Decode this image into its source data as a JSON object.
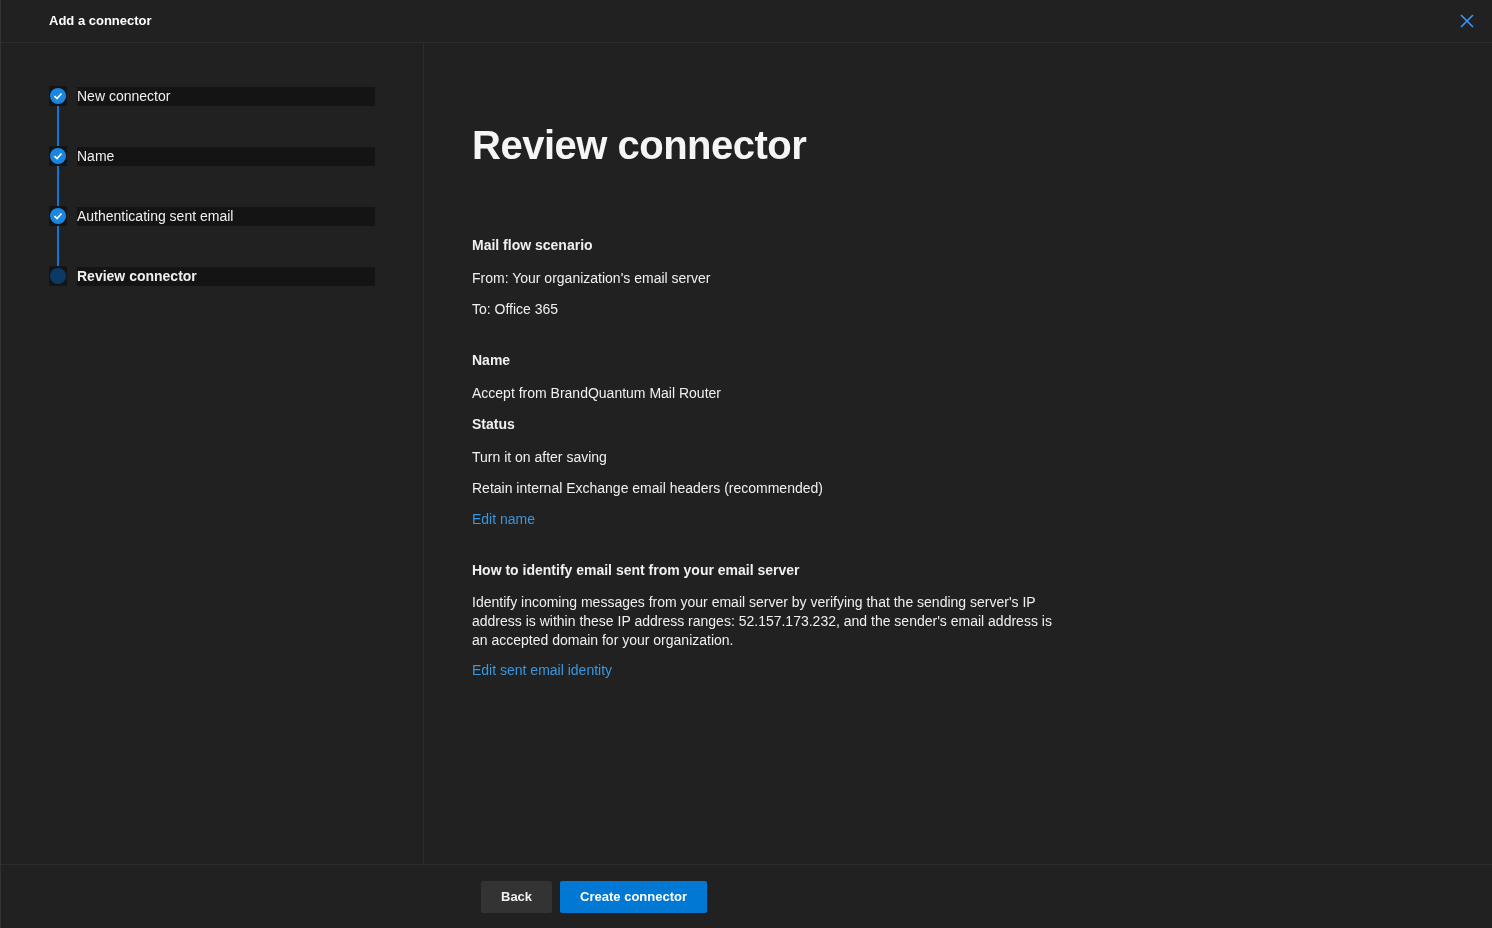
{
  "window": {
    "title": "Add a connector"
  },
  "steps": [
    {
      "label": "New connector",
      "completed": true,
      "selected": false
    },
    {
      "label": "Name",
      "completed": true,
      "selected": false
    },
    {
      "label": "Authenticating sent email",
      "completed": true,
      "selected": false
    },
    {
      "label": "Review connector",
      "completed": false,
      "selected": true
    }
  ],
  "page_title": "Review connector",
  "sections": [
    {
      "items": [
        {
          "kind": "heading",
          "text": "Mail flow scenario"
        },
        {
          "kind": "text",
          "text": "From: Your organization's email server"
        },
        {
          "kind": "text",
          "text": "To: Office 365"
        }
      ]
    },
    {
      "items": [
        {
          "kind": "heading",
          "text": "Name"
        },
        {
          "kind": "text",
          "text": "Accept from BrandQuantum Mail Router"
        },
        {
          "kind": "heading",
          "text": "Status"
        },
        {
          "kind": "text",
          "text": "Turn it on after saving"
        },
        {
          "kind": "text",
          "text": "Retain internal Exchange email headers (recommended)"
        },
        {
          "kind": "link",
          "text": "Edit name"
        }
      ]
    },
    {
      "items": [
        {
          "kind": "heading",
          "text": "How to identify email sent from your email server"
        },
        {
          "kind": "paragraph",
          "text": "Identify incoming messages from your email server by verifying that the sending server's IP address is within these IP address ranges: 52.157.173.232, and the sender's email address is an accepted domain for your organization."
        },
        {
          "kind": "link",
          "text": "Edit sent email identity"
        }
      ]
    }
  ],
  "buttons": [
    {
      "label": "Back",
      "kind": "secondary"
    },
    {
      "label": "Create connector",
      "kind": "primary"
    }
  ]
}
